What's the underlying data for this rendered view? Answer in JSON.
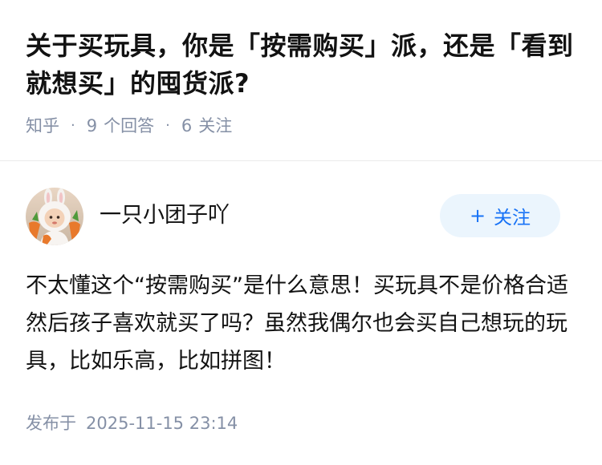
{
  "question": {
    "title": "关于买玩具，你是「按需购买」派，还是「看到就想买」的囤货派?",
    "source": "知乎",
    "answer_count": "9",
    "answer_label": "个回答",
    "follower_count": "6",
    "follower_label": "关注",
    "separator": "·"
  },
  "answer": {
    "author_name": "一只小团子吖",
    "follow_plus": "+",
    "follow_label": "关注",
    "content": "不太懂这个“按需购买”是什么意思！买玩具不是价格合适然后孩子喜欢就买了吗？虽然我偶尔也会买自己想玩的玩具，比如乐高，比如拼图！",
    "published_label": "发布于",
    "published_time": "2025-11-15 23:14"
  }
}
